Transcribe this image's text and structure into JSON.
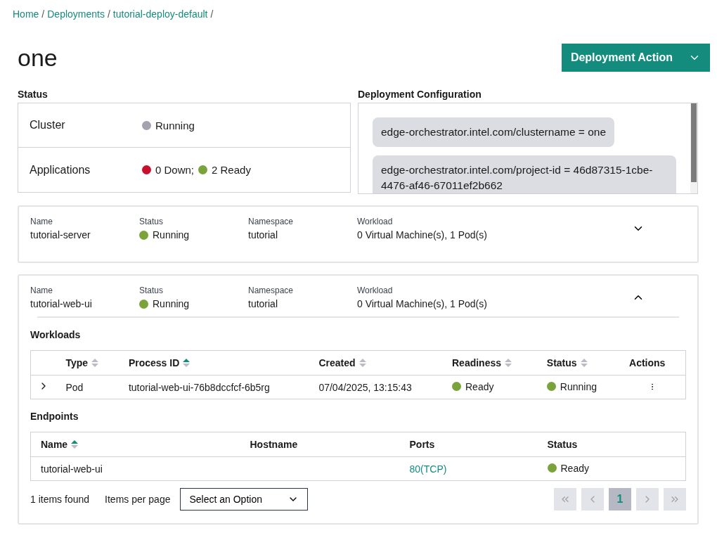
{
  "breadcrumb": {
    "separator": "/",
    "items": [
      {
        "label": "Home"
      },
      {
        "label": "Deployments"
      },
      {
        "label": "tutorial-deploy-default"
      }
    ]
  },
  "title": "one",
  "action_button": {
    "label": "Deployment Action"
  },
  "status": {
    "title": "Status",
    "rows": [
      {
        "label": "Cluster",
        "statuses": [
          {
            "text": "Running",
            "color": "#a3a3b0"
          }
        ]
      },
      {
        "label": "Applications",
        "statuses": [
          {
            "text": "0 Down;",
            "color": "#c8102e"
          },
          {
            "text": "2 Ready",
            "color": "#7aa33c"
          }
        ]
      }
    ]
  },
  "config": {
    "title": "Deployment Configuration",
    "tags": [
      "edge-orchestrator.intel.com/clustername = one",
      "edge-orchestrator.intel.com/project-id = 46d87315-1cbe-4476-af46-67011ef2b662"
    ]
  },
  "applications": [
    {
      "expanded": false,
      "fields": [
        {
          "kind": "text",
          "label": "Name",
          "value": "tutorial-server"
        },
        {
          "kind": "status",
          "label": "Status",
          "value": "Running",
          "color": "#7aa33c"
        },
        {
          "kind": "text",
          "label": "Namespace",
          "value": "tutorial"
        },
        {
          "kind": "text",
          "label": "Workload",
          "value": "0 Virtual Machine(s), 1 Pod(s)"
        }
      ]
    },
    {
      "expanded": true,
      "fields": [
        {
          "kind": "text",
          "label": "Name",
          "value": "tutorial-web-ui"
        },
        {
          "kind": "status",
          "label": "Status",
          "value": "Running",
          "color": "#7aa33c"
        },
        {
          "kind": "text",
          "label": "Namespace",
          "value": "tutorial"
        },
        {
          "kind": "text",
          "label": "Workload",
          "value": "0 Virtual Machine(s), 1 Pod(s)"
        }
      ],
      "workloads": {
        "title": "Workloads",
        "columns": [
          {
            "label": "Type",
            "sorted_ascending": false
          },
          {
            "label": "Process ID",
            "sorted_ascending": true
          },
          {
            "label": "Created",
            "sorted_ascending": false
          },
          {
            "label": "Readiness",
            "sorted_ascending": false
          },
          {
            "label": "Status",
            "sorted_ascending": false
          },
          {
            "label": "Actions"
          }
        ],
        "rows": [
          {
            "expanded": false,
            "type": "Pod",
            "process_id": "tutorial-web-ui-76b8dccfcf-6b5rg",
            "created": "07/04/2025, 13:15:43",
            "readiness": {
              "text": "Ready",
              "color": "#7aa33c"
            },
            "status": {
              "text": "Running",
              "color": "#7aa33c"
            }
          }
        ]
      },
      "endpoints": {
        "title": "Endpoints",
        "columns": [
          {
            "label": "Name",
            "sorted_ascending": true
          },
          {
            "label": "Hostname"
          },
          {
            "label": "Ports"
          },
          {
            "label": "Status"
          }
        ],
        "rows": [
          {
            "name": "tutorial-web-ui",
            "ports": "80(TCP)",
            "status": {
              "text": "Ready",
              "color": "#7aa33c"
            }
          }
        ]
      },
      "pagination": {
        "found": "1 items found",
        "per_page_label": "Items per page",
        "select_placeholder": "Select an Option",
        "pages": [
          {
            "label": "1",
            "selected": true
          }
        ],
        "first_disabled": true,
        "prev_disabled": true,
        "next_disabled": true,
        "last_disabled": true
      }
    }
  ]
}
